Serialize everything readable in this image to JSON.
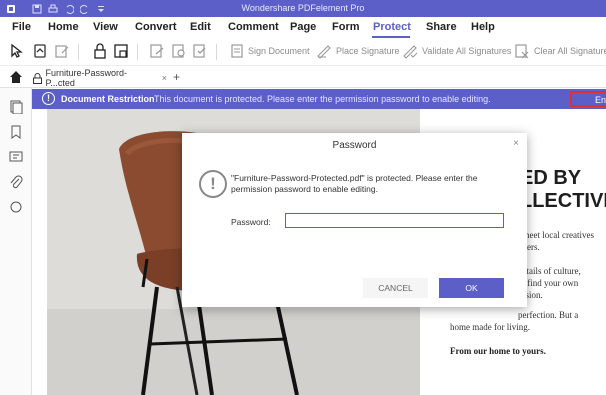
{
  "titlebar": {
    "title": "Wondershare PDFelement Pro"
  },
  "menu": {
    "items": [
      "File",
      "Home",
      "View",
      "Convert",
      "Edit",
      "Comment",
      "Page",
      "Form",
      "Protect",
      "Share",
      "Help"
    ],
    "active": "Protect"
  },
  "toolbar": {
    "sign_document": "Sign Document",
    "place_signature": "Place Signature",
    "validate_all": "Validate All Signatures",
    "clear_all": "Clear All Signatures"
  },
  "tab": {
    "name": "Furniture-Password-P...cted",
    "close": "×",
    "add": "+"
  },
  "restriction": {
    "icon": "!",
    "label": "Document Restriction",
    "message": "This document is protected. Please enter the permission password to enable editing.",
    "button": "Enable Editing"
  },
  "document": {
    "headline1": "ED BY",
    "headline2": "LLECTIVE",
    "p1a": ", meet local creatives",
    "p1b": "gners.",
    "p2a": "details of culture,",
    "p2b": "to find your own",
    "p2c": "ession.",
    "p3a": "perfection. But a",
    "p3b": "home made for living.",
    "p4": "From our home to yours."
  },
  "dialog": {
    "title": "Password",
    "close": "×",
    "warning_icon": "!",
    "message": "\"Furniture-Password-Protected.pdf\" is protected. Please enter the permission password to enable editing.",
    "password_label": "Password:",
    "password_value": "",
    "cancel": "CANCEL",
    "ok": "OK"
  },
  "colors": {
    "accent": "#5b5fc7",
    "highlight": "#e0322d"
  }
}
